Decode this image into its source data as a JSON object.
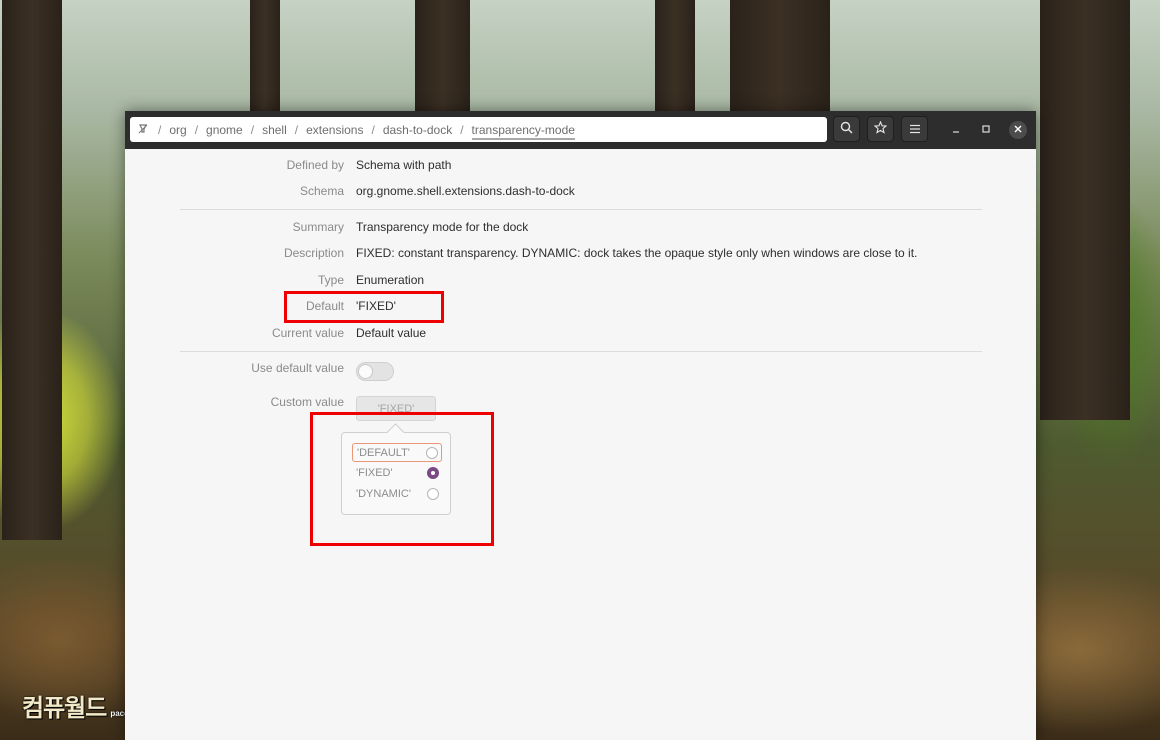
{
  "pathbar": {
    "segments": [
      "org",
      "gnome",
      "shell",
      "extensions",
      "dash-to-dock",
      "transparency-mode"
    ],
    "separator": "/"
  },
  "icons": {
    "pin": "pin-icon",
    "search": "search-icon",
    "bookmark": "star-icon",
    "menu": "hamburger-menu-icon",
    "minimize": "minimize-icon",
    "maximize": "maximize-icon",
    "close": "close-icon"
  },
  "details": {
    "defined_by": {
      "label": "Defined by",
      "value": "Schema with path"
    },
    "schema": {
      "label": "Schema",
      "value": "org.gnome.shell.extensions.dash-to-dock"
    },
    "summary": {
      "label": "Summary",
      "value": "Transparency mode for the dock"
    },
    "description": {
      "label": "Description",
      "value": "FIXED: constant transparency. DYNAMIC: dock takes the opaque style only when windows are close to it."
    },
    "type": {
      "label": "Type",
      "value": "Enumeration"
    },
    "default": {
      "label": "Default",
      "value": "'FIXED'"
    },
    "current_value": {
      "label": "Current value",
      "value": "Default value"
    }
  },
  "settings": {
    "use_default": {
      "label": "Use default value",
      "enabled": false
    },
    "custom_value": {
      "label": "Custom value",
      "selected": "'FIXED'"
    }
  },
  "popover": {
    "options": [
      {
        "label": "'DEFAULT'",
        "checked": false,
        "focused": true
      },
      {
        "label": "'FIXED'",
        "checked": true,
        "focused": false
      },
      {
        "label": "'DYNAMIC'",
        "checked": false,
        "focused": false
      }
    ]
  },
  "watermark": {
    "brand": "컴퓨월드",
    "site": "pacom.tistory.com"
  },
  "colors": {
    "annotation": "#ee0000",
    "radio_checked": "#7a4a86",
    "headerbar": "#2d2d2d"
  }
}
